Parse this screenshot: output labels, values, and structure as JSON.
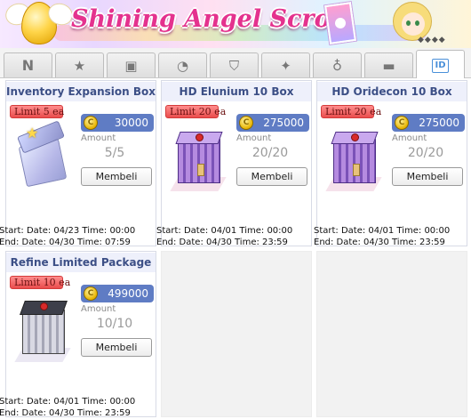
{
  "banner": {
    "title": "Shining Angel Scroll",
    "dots": "◆◆◆◆"
  },
  "tabs": [
    {
      "label": "N",
      "icon": "n-icon"
    },
    {
      "label": "★",
      "icon": "star-icon"
    },
    {
      "label": "▣",
      "icon": "costume-icon"
    },
    {
      "label": "◔",
      "icon": "timer-icon"
    },
    {
      "label": "⛉",
      "icon": "shield-icon"
    },
    {
      "label": "✦",
      "icon": "magic-icon"
    },
    {
      "label": "♁",
      "icon": "potion-icon"
    },
    {
      "label": "▬",
      "icon": "box-icon"
    },
    {
      "label": "ID",
      "icon": "id-icon",
      "active": true
    }
  ],
  "items": [
    {
      "title": "Inventory Expansion Box",
      "limit": "Limit 5 ea",
      "price": "30000",
      "amount_label": "Amount",
      "amount": "5/5",
      "buy_label": "Membeli",
      "start": "Start: Date: 04/23 Time: 00:00",
      "end": "End: Date: 04/30 Time: 07:59"
    },
    {
      "title": "HD Elunium 10 Box",
      "limit": "Limit 20 ea",
      "price": "275000",
      "amount_label": "Amount",
      "amount": "20/20",
      "buy_label": "Membeli",
      "start": "Start: Date: 04/01 Time: 00:00",
      "end": "End: Date: 04/30 Time: 23:59"
    },
    {
      "title": "HD Oridecon 10 Box",
      "limit": "Limit 20 ea",
      "price": "275000",
      "amount_label": "Amount",
      "amount": "20/20",
      "buy_label": "Membeli",
      "start": "Start: Date: 04/01 Time: 00:00",
      "end": "End: Date: 04/30 Time: 23:59"
    },
    {
      "title": "Refine Limited Package",
      "limit": "Limit 10 ea",
      "price": "499000",
      "amount_label": "Amount",
      "amount": "10/10",
      "buy_label": "Membeli",
      "start": "Start: Date: 04/01 Time: 00:00",
      "end": "End: Date: 04/30 Time: 23:59"
    }
  ],
  "colors": {
    "accent": "#4a90d9",
    "title_text": "#3c4f86",
    "price_bg": "#5f7cc4",
    "limit_bg": "#ea4d4d"
  }
}
